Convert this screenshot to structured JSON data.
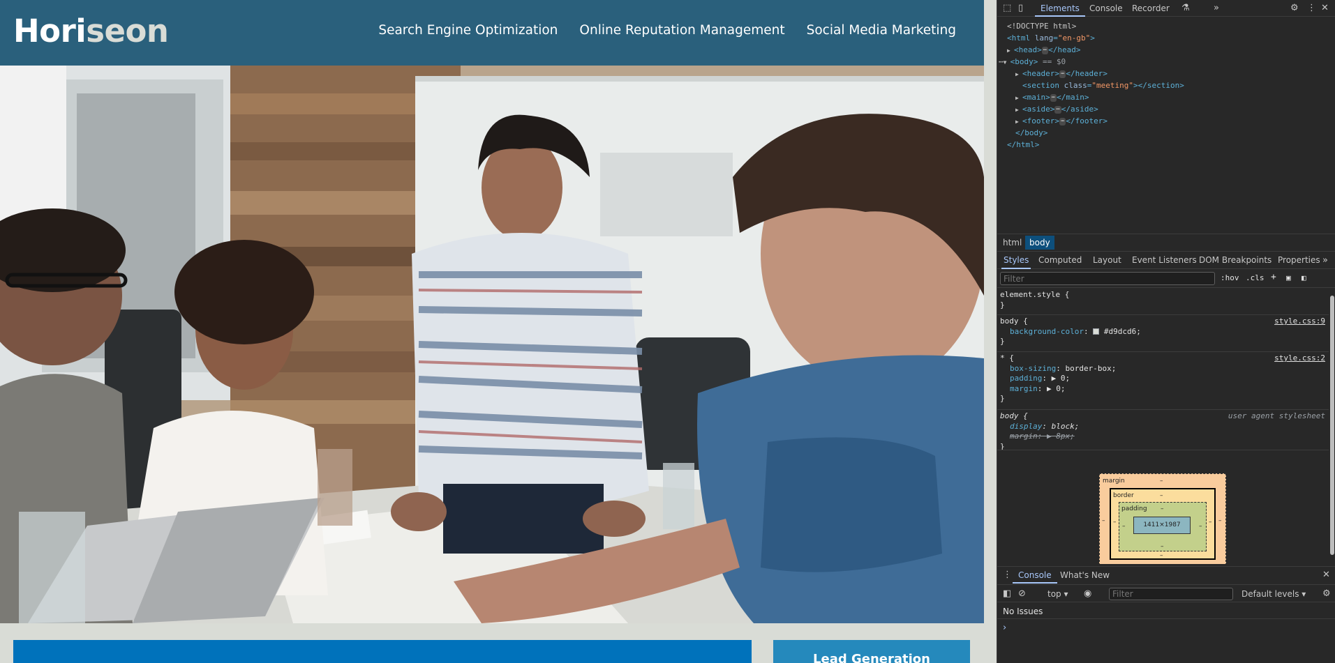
{
  "site": {
    "logo_main": "Hori",
    "logo_accent": "seon",
    "nav": [
      "Search Engine Optimization",
      "Online Reputation Management",
      "Social Media Marketing"
    ],
    "aside_title": "Lead Generation",
    "colors": {
      "header": "#2a607c",
      "main_box": "#0072bb",
      "aside_box": "#2589bc",
      "background": "#d9dcd6"
    }
  },
  "devtools": {
    "top_tabs": [
      "Elements",
      "Console",
      "Recorder"
    ],
    "dom": {
      "doctype": "<!DOCTYPE html>",
      "html_open": "<html",
      "html_attr": "lang",
      "html_attr_val": "\"en-gb\"",
      "head": "head",
      "body": "body",
      "body_suffix": "== $0",
      "header": "header",
      "section": "section",
      "section_attr": "class",
      "section_attr_val": "\"meeting\"",
      "main": "main",
      "aside": "aside",
      "footer": "footer",
      "close_body": "</body>",
      "close_html": "</html>"
    },
    "breadcrumbs": [
      "html",
      "body"
    ],
    "sub_tabs": [
      "Styles",
      "Computed",
      "Layout",
      "Event Listeners",
      "DOM Breakpoints",
      "Properties"
    ],
    "filter_placeholder": "Filter",
    "hov": ":hov",
    "cls": ".cls",
    "styles": {
      "element_style": "element.style {",
      "close": "}",
      "rule1_selector": "body {",
      "rule1_source": "style.css:9",
      "rule1_prop": "background-color",
      "rule1_val": "#d9dcd6;",
      "rule2_selector": "* {",
      "rule2_source": "style.css:2",
      "rule2_props": [
        {
          "name": "box-sizing",
          "value": "border-box;"
        },
        {
          "name": "padding",
          "value": "▶ 0;"
        },
        {
          "name": "margin",
          "value": "▶ 0;"
        }
      ],
      "rule3_selector": "body {",
      "rule3_source": "user agent stylesheet",
      "rule3_prop": "display",
      "rule3_val": "block;",
      "rule3_struck": "margin: ▶ 8px;"
    },
    "box_model": {
      "margin": "margin",
      "border": "border",
      "padding": "padding",
      "content": "1411×1987",
      "dash": "–"
    },
    "drawer_tabs": [
      "Console",
      "What's New"
    ],
    "console_context": "top",
    "console_filter_placeholder": "Filter",
    "default_levels": "Default levels",
    "no_issues": "No Issues",
    "prompt": "›"
  }
}
